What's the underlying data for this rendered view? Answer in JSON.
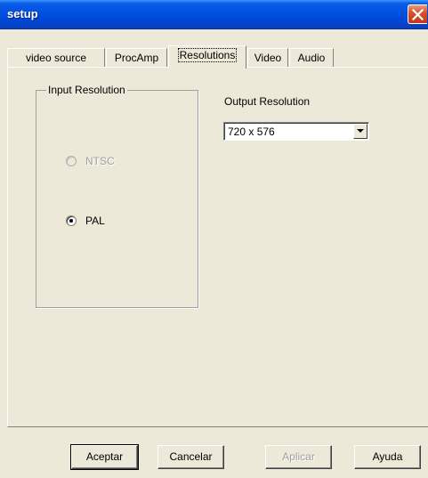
{
  "window": {
    "title": "setup",
    "close_icon": "close-icon"
  },
  "tabs": [
    {
      "label": "video source",
      "selected": false
    },
    {
      "label": "ProcAmp",
      "selected": false
    },
    {
      "label": "Resolutions",
      "selected": true
    },
    {
      "label": "Video",
      "selected": false
    },
    {
      "label": "Audio",
      "selected": false
    }
  ],
  "input_resolution": {
    "group_label": "Input Resolution",
    "options": [
      {
        "label": "NTSC",
        "checked": false,
        "enabled": false
      },
      {
        "label": "PAL",
        "checked": true,
        "enabled": true
      }
    ]
  },
  "output_resolution": {
    "label": "Output Resolution",
    "selected_value": "720 x 576"
  },
  "buttons": {
    "ok": "Aceptar",
    "cancel": "Cancelar",
    "apply": "Aplicar",
    "help": "Ayuda"
  }
}
